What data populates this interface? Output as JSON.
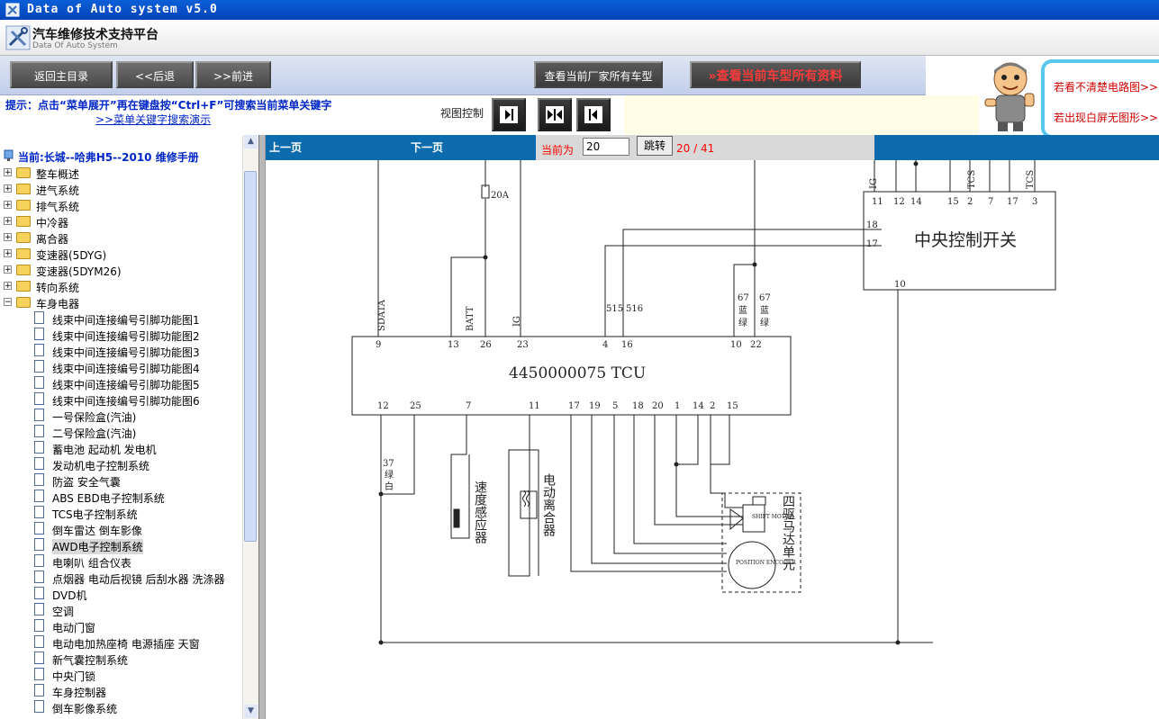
{
  "window": {
    "title": "Data of Auto system v5.0"
  },
  "header": {
    "logo_cn": "汽车维修技术支持平台",
    "logo_en": "Data Of Auto System"
  },
  "toolbar": {
    "home": "返回主目录",
    "back": "<<后退",
    "forward": ">>前进",
    "brand_models": "查看当前厂家所有车型",
    "all_data": "查看当前车型所有资料"
  },
  "ad": {
    "line1": "若看不清楚电路图>>",
    "line2": "若出现白屏无图形>>"
  },
  "hint": {
    "text": "提示：点击“菜单展开”再在键盘按“Ctrl+F”可搜索当前菜单关键字",
    "link": ">>菜单关键字搜索演示"
  },
  "view": {
    "label": "视图控制"
  },
  "tree": {
    "current": "当前:长城--哈弗H5--2010 维修手册",
    "folders": [
      "整车概述",
      "进气系统",
      "排气系统",
      "中冷器",
      "离合器",
      "变速器(5DYG)",
      "变速器(5DYM26)",
      "转向系统",
      "车身电器"
    ],
    "docs": [
      "线束中间连接编号引脚功能图1",
      "线束中间连接编号引脚功能图2",
      "线束中间连接编号引脚功能图3",
      "线束中间连接编号引脚功能图4",
      "线束中间连接编号引脚功能图5",
      "线束中间连接编号引脚功能图6",
      "一号保险盒(汽油)",
      "二号保险盒(汽油)",
      "蓄电池 起动机 发电机",
      "发动机电子控制系统",
      "防盗 安全气囊",
      "ABS EBD电子控制系统",
      "TCS电子控制系统",
      "倒车雷达 倒车影像",
      "AWD电子控制系统",
      "电喇叭 组合仪表",
      "点烟器 电动后视镜 后刮水器 洗涤器",
      "DVD机",
      "空调",
      "电动门窗",
      "电动电加热座椅 电源插座 天窗",
      "新气囊控制系统",
      "中央门锁",
      "车身控制器",
      "倒车影像系统"
    ],
    "selected_index": 14
  },
  "pager": {
    "prev": "上一页",
    "next": "下一页",
    "current_label": "当前为",
    "page_value": "20",
    "jump": "跳转",
    "page_count": "20 / 41"
  },
  "diagram": {
    "tcu_label": "4450000075 TCU",
    "switch_label": "中央控制开关",
    "fuse": "20A",
    "tcu_top_pins": [
      "9",
      "13",
      "26",
      "23",
      "4",
      "16",
      "10",
      "22"
    ],
    "tcu_bottom_pins": [
      "12",
      "25",
      "7",
      "11",
      "17",
      "19",
      "5",
      "18",
      "20",
      "1",
      "14",
      "2",
      "15"
    ],
    "switch_top_pins": [
      "11",
      "12",
      "14",
      "15",
      "2",
      "7",
      "17",
      "3"
    ],
    "switch_side_pins": [
      "18",
      "17"
    ],
    "switch_bottom_pin": "10",
    "signals": [
      "SDATA",
      "BATT",
      "IG",
      "515",
      "516",
      "TCS",
      "IG",
      "TCS"
    ],
    "wire_notes": [
      "67",
      "蓝",
      "绿",
      "67",
      "蓝",
      "绿",
      "37",
      "绿",
      "白"
    ],
    "speed_sensor": "速度感应器",
    "clutch": "电动离合器",
    "motor_unit": "四驱马达单元",
    "shift_motor": "SHIFT MOTOR",
    "position_encoder": "POSITION ENCODER"
  }
}
